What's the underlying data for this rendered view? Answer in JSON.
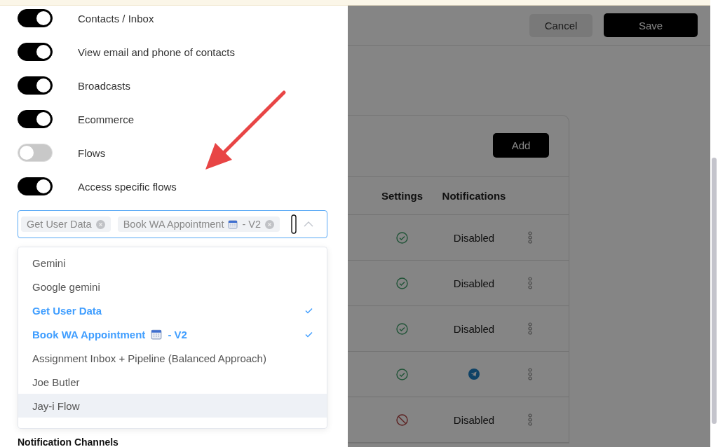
{
  "permissions": [
    {
      "label": "Contacts / Inbox",
      "on": true
    },
    {
      "label": "View email and phone of contacts",
      "on": true
    },
    {
      "label": "Broadcasts",
      "on": true
    },
    {
      "label": "Ecommerce",
      "on": true
    },
    {
      "label": "Flows",
      "on": false
    },
    {
      "label": "Access specific flows",
      "on": true
    }
  ],
  "flow_select": {
    "tags": [
      {
        "label": "Get User Data"
      },
      {
        "label": "Book WA Appointment",
        "suffix": "- V2"
      }
    ],
    "options": [
      {
        "label": "Gemini",
        "selected": false,
        "hovered": false
      },
      {
        "label": "Google gemini",
        "selected": false,
        "hovered": false
      },
      {
        "label": "Get User Data",
        "selected": true,
        "hovered": false
      },
      {
        "label": "Book WA Appointment",
        "suffix": "- V2",
        "selected": true,
        "hovered": false
      },
      {
        "label": "Assignment Inbox + Pipeline (Balanced Approach)",
        "selected": false,
        "hovered": false
      },
      {
        "label": "Joe Butler",
        "selected": false,
        "hovered": false
      },
      {
        "label": "Jay-i Flow",
        "selected": false,
        "hovered": true
      }
    ]
  },
  "section_heading": "Notification Channels",
  "header_buttons": {
    "cancel": "Cancel",
    "save": "Save"
  },
  "card": {
    "add_button": "Add",
    "columns": [
      "Settings",
      "Notifications"
    ],
    "rows": [
      {
        "settings": {
          "kind": "check"
        },
        "notification": {
          "kind": "text",
          "text": "Disabled"
        }
      },
      {
        "settings": {
          "kind": "check"
        },
        "notification": {
          "kind": "text",
          "text": "Disabled"
        }
      },
      {
        "settings": {
          "kind": "check"
        },
        "notification": {
          "kind": "text",
          "text": "Disabled"
        }
      },
      {
        "settings": {
          "kind": "check"
        },
        "notification": {
          "kind": "telegram"
        }
      },
      {
        "settings": {
          "kind": "blocked"
        },
        "notification": {
          "kind": "text",
          "text": "Disabled"
        }
      }
    ]
  }
}
